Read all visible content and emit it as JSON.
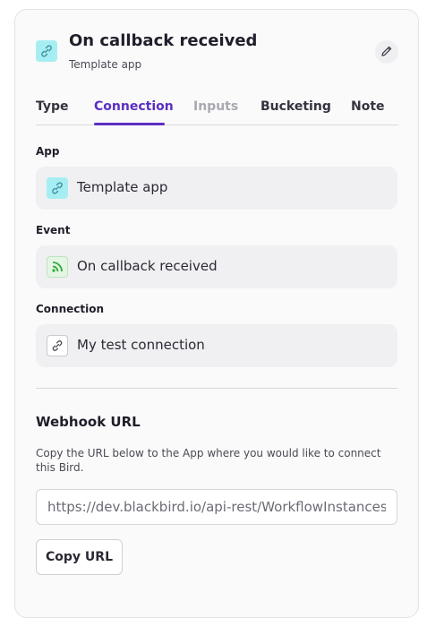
{
  "header": {
    "title": "On callback received",
    "subtitle": "Template app",
    "app_icon": "link-icon",
    "edit_icon": "pencil-icon"
  },
  "tabs": [
    {
      "label": "Type",
      "state": "normal"
    },
    {
      "label": "Connection",
      "state": "active"
    },
    {
      "label": "Inputs",
      "state": "disabled"
    },
    {
      "label": "Bucketing",
      "state": "normal"
    },
    {
      "label": "Note",
      "state": "normal"
    }
  ],
  "fields": {
    "app": {
      "label": "App",
      "value": "Template app",
      "icon": "link-icon"
    },
    "event": {
      "label": "Event",
      "value": "On callback received",
      "icon": "rss-icon"
    },
    "connection": {
      "label": "Connection",
      "value": "My test connection",
      "icon": "chain-link-icon"
    }
  },
  "webhook": {
    "title": "Webhook URL",
    "description": "Copy the URL below to the App where you would like to connect this Bird.",
    "url": "https://dev.blackbird.io/api-rest/WorkflowInstances/",
    "copy_label": "Copy URL"
  },
  "colors": {
    "accent": "#5b2fc2",
    "app_icon_bg": "#a7eef2",
    "event_icon": "#2eaa3a"
  }
}
